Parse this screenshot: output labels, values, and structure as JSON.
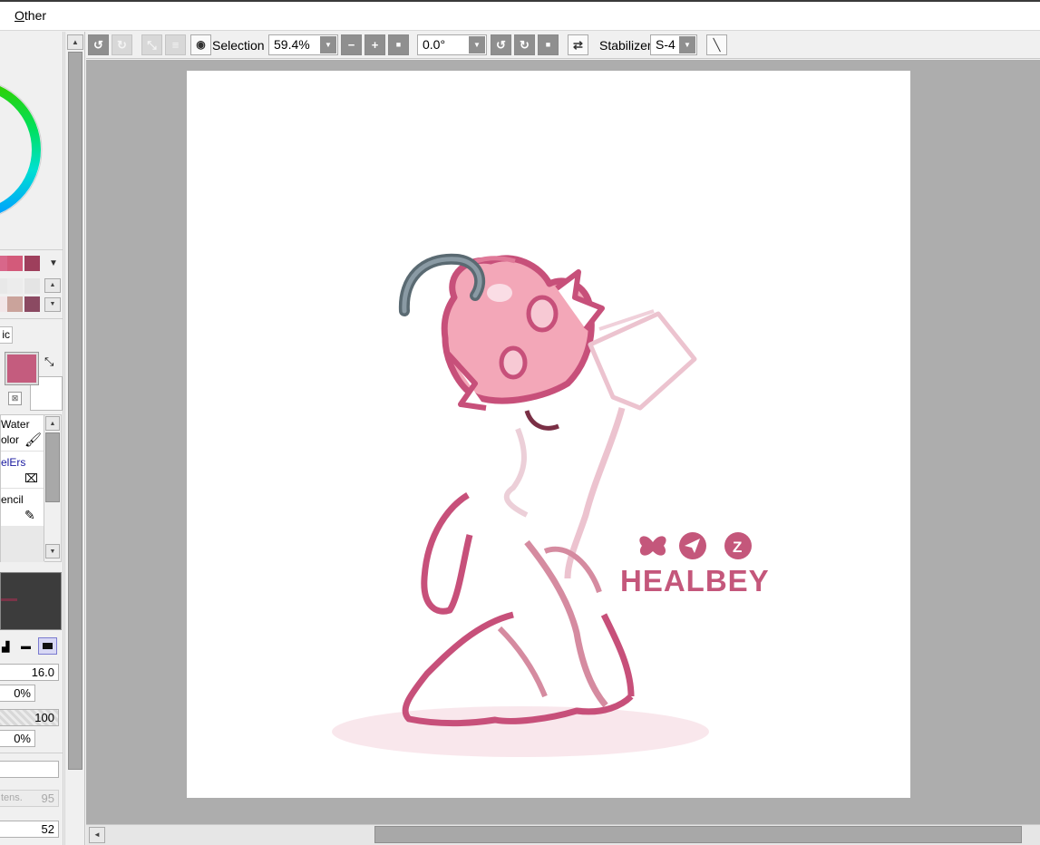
{
  "menu": {
    "other_label": "Other"
  },
  "toolbar": {
    "selection_label": "Selection",
    "zoom_value": "59.4%",
    "rotation_value": "0.0°",
    "stabilizer_label": "Stabilizer",
    "stabilizer_value": "S-4"
  },
  "left_panel": {
    "mode_tab_partial": "ic",
    "tools": [
      {
        "line1": "Water",
        "line2": "olor"
      },
      {
        "line1": "elErs"
      },
      {
        "line1": "encil"
      }
    ],
    "brush_size": "16.0",
    "min_size": "0%",
    "density": "100",
    "min_density": "0%",
    "intensity_label": "tens.",
    "intensity_value": "95",
    "bottom_value": "52"
  },
  "artwork": {
    "watermark": "HEALBEY"
  },
  "colors": {
    "primary": "#c45c7e",
    "secondary": "#ffffff",
    "canvas_bg": "#adadad",
    "line_art": "#c05878"
  }
}
